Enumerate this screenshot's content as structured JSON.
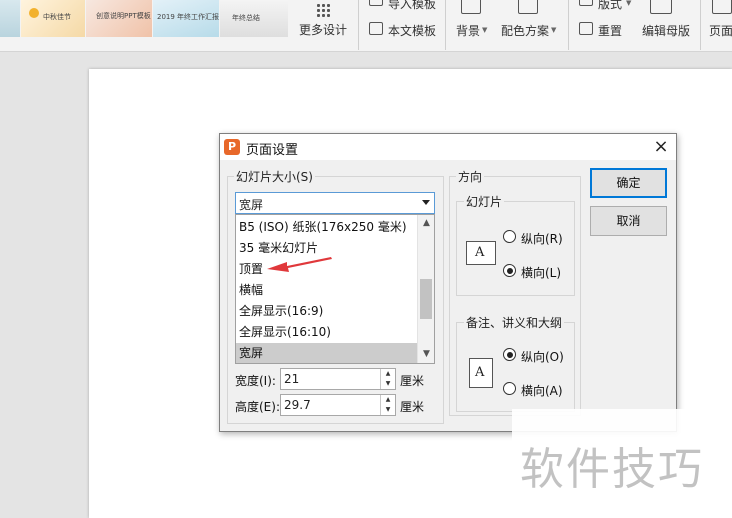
{
  "ribbon": {
    "thumbnails": [
      "中秋佳节",
      "创意说明PPT模板",
      "2019 年终工作汇报模板",
      "年终总结"
    ],
    "more_designs": "更多设计",
    "import_template": "导入模板",
    "this_template": "本文模板",
    "background": "背景",
    "color_scheme": "配色方案",
    "layout": "版式",
    "reset": "重置",
    "edit_master": "编辑母版",
    "page": "页面"
  },
  "dialog": {
    "title": "页面设置",
    "close": "×",
    "slide_size_group": "幻灯片大小(S)",
    "slide_size_value": "宽屏",
    "size_options": [
      "B5 (ISO) 纸张(176x250 毫米)",
      "35 毫米幻灯片",
      "顶置",
      "横幅",
      "全屏显示(16:9)",
      "全屏显示(16:10)",
      "宽屏"
    ],
    "selected_option": "宽屏",
    "width_label": "宽度(I):",
    "width_value": "21",
    "height_label": "高度(E):",
    "height_value": "29.7",
    "unit": "厘米",
    "orientation_group": "方向",
    "slides_group": "幻灯片",
    "slides_portrait": "纵向(R)",
    "slides_landscape": "横向(L)",
    "slides_selected": "landscape",
    "notes_group": "备注、讲义和大纲",
    "notes_portrait": "纵向(O)",
    "notes_landscape": "横向(A)",
    "notes_selected": "portrait",
    "ok": "确定",
    "cancel": "取消",
    "page_glyph": "A"
  },
  "app_icon_letter": "P",
  "watermark": "软件技巧",
  "colors": {
    "focus": "#0078d7",
    "annotation_arrow": "#e0383b",
    "app_icon": "#e8682a"
  }
}
